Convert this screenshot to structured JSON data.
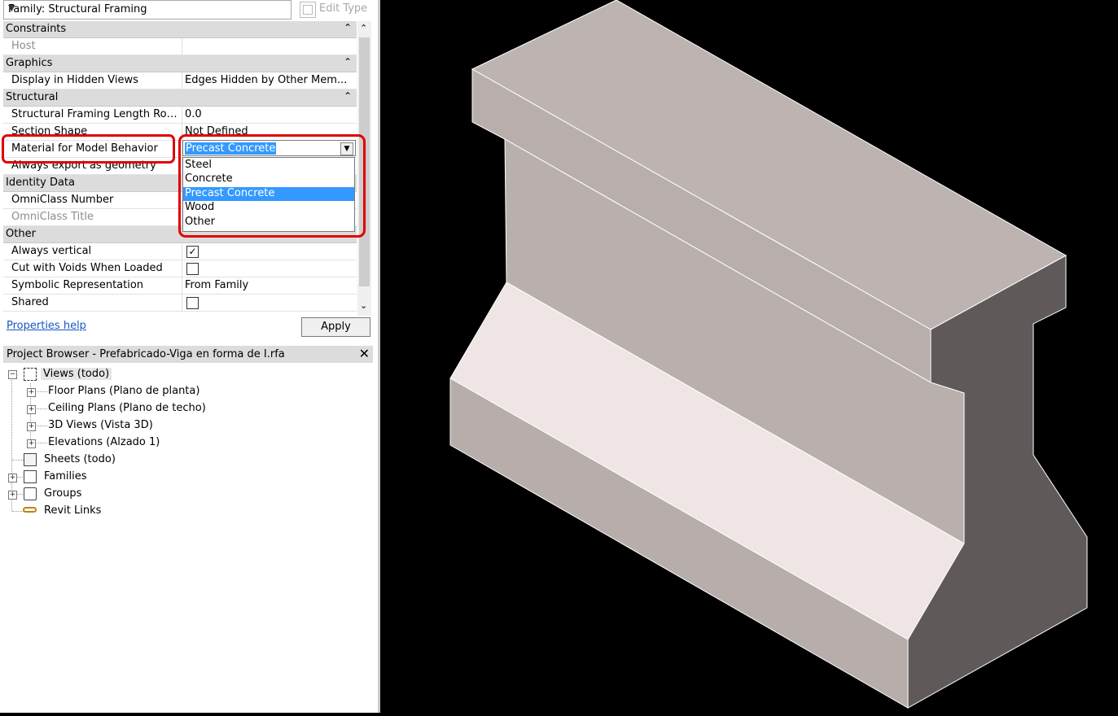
{
  "type_selector": {
    "value": "Family: Structural Framing",
    "edit_type_label": "Edit Type"
  },
  "properties": {
    "sections": {
      "constraints": "Constraints",
      "graphics": "Graphics",
      "structural": "Structural",
      "identity": "Identity Data",
      "other": "Other"
    },
    "rows": {
      "host": {
        "name": "Host",
        "value": ""
      },
      "display_hidden": {
        "name": "Display in Hidden Views",
        "value": "Edges Hidden by Other Mem..."
      },
      "length_rounding": {
        "name": "Structural Framing Length Roun...",
        "value": "0.0"
      },
      "section_shape": {
        "name": "Section Shape",
        "value": "Not Defined"
      },
      "material_behavior": {
        "name": "Material for Model Behavior",
        "value": "Precast Concrete"
      },
      "always_export": {
        "name": "Always export as geometry",
        "value": ""
      },
      "omniclass_number": {
        "name": "OmniClass Number",
        "value": ""
      },
      "omniclass_title": {
        "name": "OmniClass Title",
        "value": ""
      },
      "always_vertical": {
        "name": "Always vertical",
        "checked": true
      },
      "cut_voids": {
        "name": "Cut with Voids When Loaded",
        "checked": false
      },
      "symbolic": {
        "name": "Symbolic Representation",
        "value": "From Family"
      },
      "shared": {
        "name": "Shared",
        "checked": false
      }
    },
    "dropdown_options": [
      "Steel",
      "Concrete",
      "Precast Concrete",
      "Wood",
      "Other"
    ],
    "help_link": "Properties help",
    "apply_label": "Apply",
    "checkmark": "✓"
  },
  "project_browser": {
    "title": "Project Browser - Prefabricado-Viga en forma de I.rfa",
    "close": "✕",
    "items": {
      "views": "Views (todo)",
      "floor_plans": "Floor Plans (Plano de planta)",
      "ceiling_plans": "Ceiling Plans (Plano de techo)",
      "views_3d": "3D Views (Vista 3D)",
      "elevations": "Elevations (Alzado 1)",
      "sheets": "Sheets (todo)",
      "families": "Families",
      "groups": "Groups",
      "revit_links": "Revit Links"
    }
  },
  "colors": {
    "highlight_red": "#e10000",
    "selection_blue": "#3399ff",
    "beam_top": "#b7adab",
    "beam_dark": "#5f5a59",
    "beam_light": "#efe5e4"
  }
}
